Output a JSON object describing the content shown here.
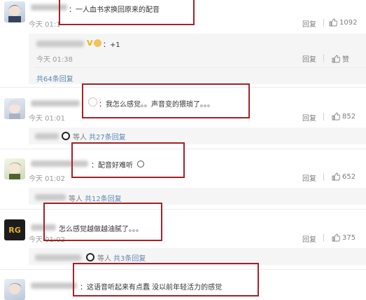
{
  "comments": [
    {
      "text": "：一人血书求换回原来的配音",
      "time": "今天 01:1",
      "reply_label": "回复",
      "likes": "1092"
    },
    {
      "text": "：我怎么感觉。。声音变的猥琐了。。。",
      "time": "今天 01:01",
      "reply_label": "回复",
      "likes": "852"
    },
    {
      "text": "：配音好难听",
      "time": "今天 01:02",
      "reply_label": "回复",
      "likes": "652"
    },
    {
      "text": "怎么感觉越做越油腻了。。。",
      "time": "今天 01:02",
      "reply_label": "回复",
      "likes": "375"
    },
    {
      "text": "：这语音听起来有点蠢  没以前年轻活力的感觉"
    }
  ],
  "subreply": {
    "text": "：+1",
    "time": "今天 01:38",
    "reply_label": "回复",
    "like_label": "赞",
    "count_label": "共64条回复"
  },
  "more_replies": [
    {
      "prefix": "等人",
      "link": "共27条回复"
    },
    {
      "prefix": "等人",
      "link": "共12条回复"
    },
    {
      "prefix": "等人",
      "link": "共3条回复"
    }
  ],
  "colors": {
    "highlight_box": "#a32228",
    "link": "#5b87b5",
    "subreply_bg": "#f5f5f5"
  },
  "icons": [
    "thumbs-up-icon",
    "panda-emoji-icon",
    "rabbit-emoji-icon",
    "vip-icon",
    "blushing-emoji-icon"
  ]
}
